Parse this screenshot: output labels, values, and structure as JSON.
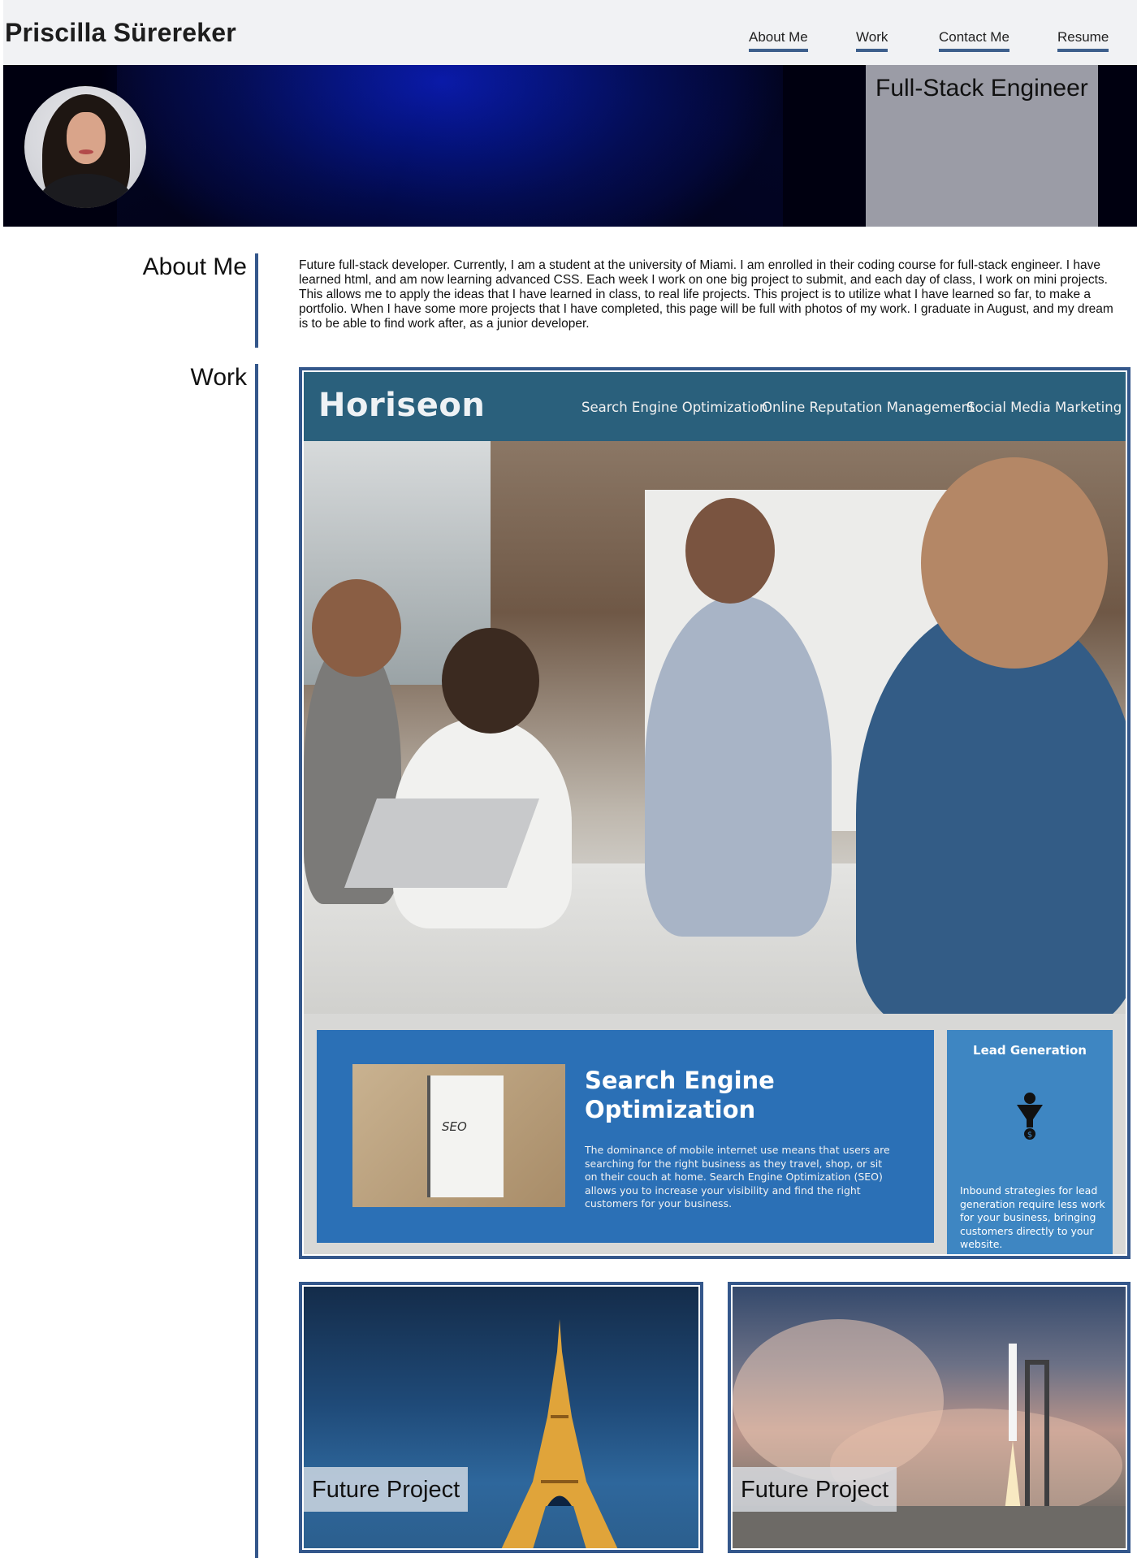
{
  "header": {
    "name": "Priscilla Sürereker",
    "nav": [
      {
        "label": "About Me"
      },
      {
        "label": "Work"
      },
      {
        "label": "Contact Me"
      },
      {
        "label": "Resume"
      }
    ]
  },
  "hero": {
    "role": "Full-Stack Engineer"
  },
  "about": {
    "heading": "About Me",
    "text": "Future full-stack developer. Currently, I am a student at the university of Miami. I am enrolled in their coding course for full-stack engineer. I have learned html, and am now learning advanced CSS. Each week I work on one big project to submit, and each day of class, I work on mini projects. This allows me to apply the ideas that I have learned in class, to real life projects. This project is to utilize what I have learned so far, to make a portfolio. When I have some more projects that I have completed, this page will be full with photos of my work. I graduate in August, and my dream is to be able to find work after, as a junior developer."
  },
  "work": {
    "heading": "Work",
    "featured": {
      "logo": "Horiseon",
      "nav": [
        "Search Engine Optimization",
        "Online Reputation Management",
        "Social Media Marketing"
      ],
      "seo_title_line1": "Search Engine",
      "seo_title_line2": "Optimization",
      "seo_text": "The dominance of mobile internet use means that users are searching for the right business as they travel, shop, or sit on their couch at home. Search Engine Optimization (SEO) allows you to increase your visibility and find the right customers for your business.",
      "seo_note_word": "SEO",
      "lead_title": "Lead Generation",
      "lead_text": "Inbound strategies for lead generation require less work for your business, bringing customers directly to your website."
    },
    "projects": [
      {
        "label": "Future Project",
        "image": "eiffel-tower-night"
      },
      {
        "label": "Future Project",
        "image": "rocket-launch"
      }
    ]
  },
  "colors": {
    "accent": "#34578b",
    "header_bg": "#f1f2f4",
    "role_box": "#9b9ca6",
    "hero_bg": "#020a4a"
  }
}
